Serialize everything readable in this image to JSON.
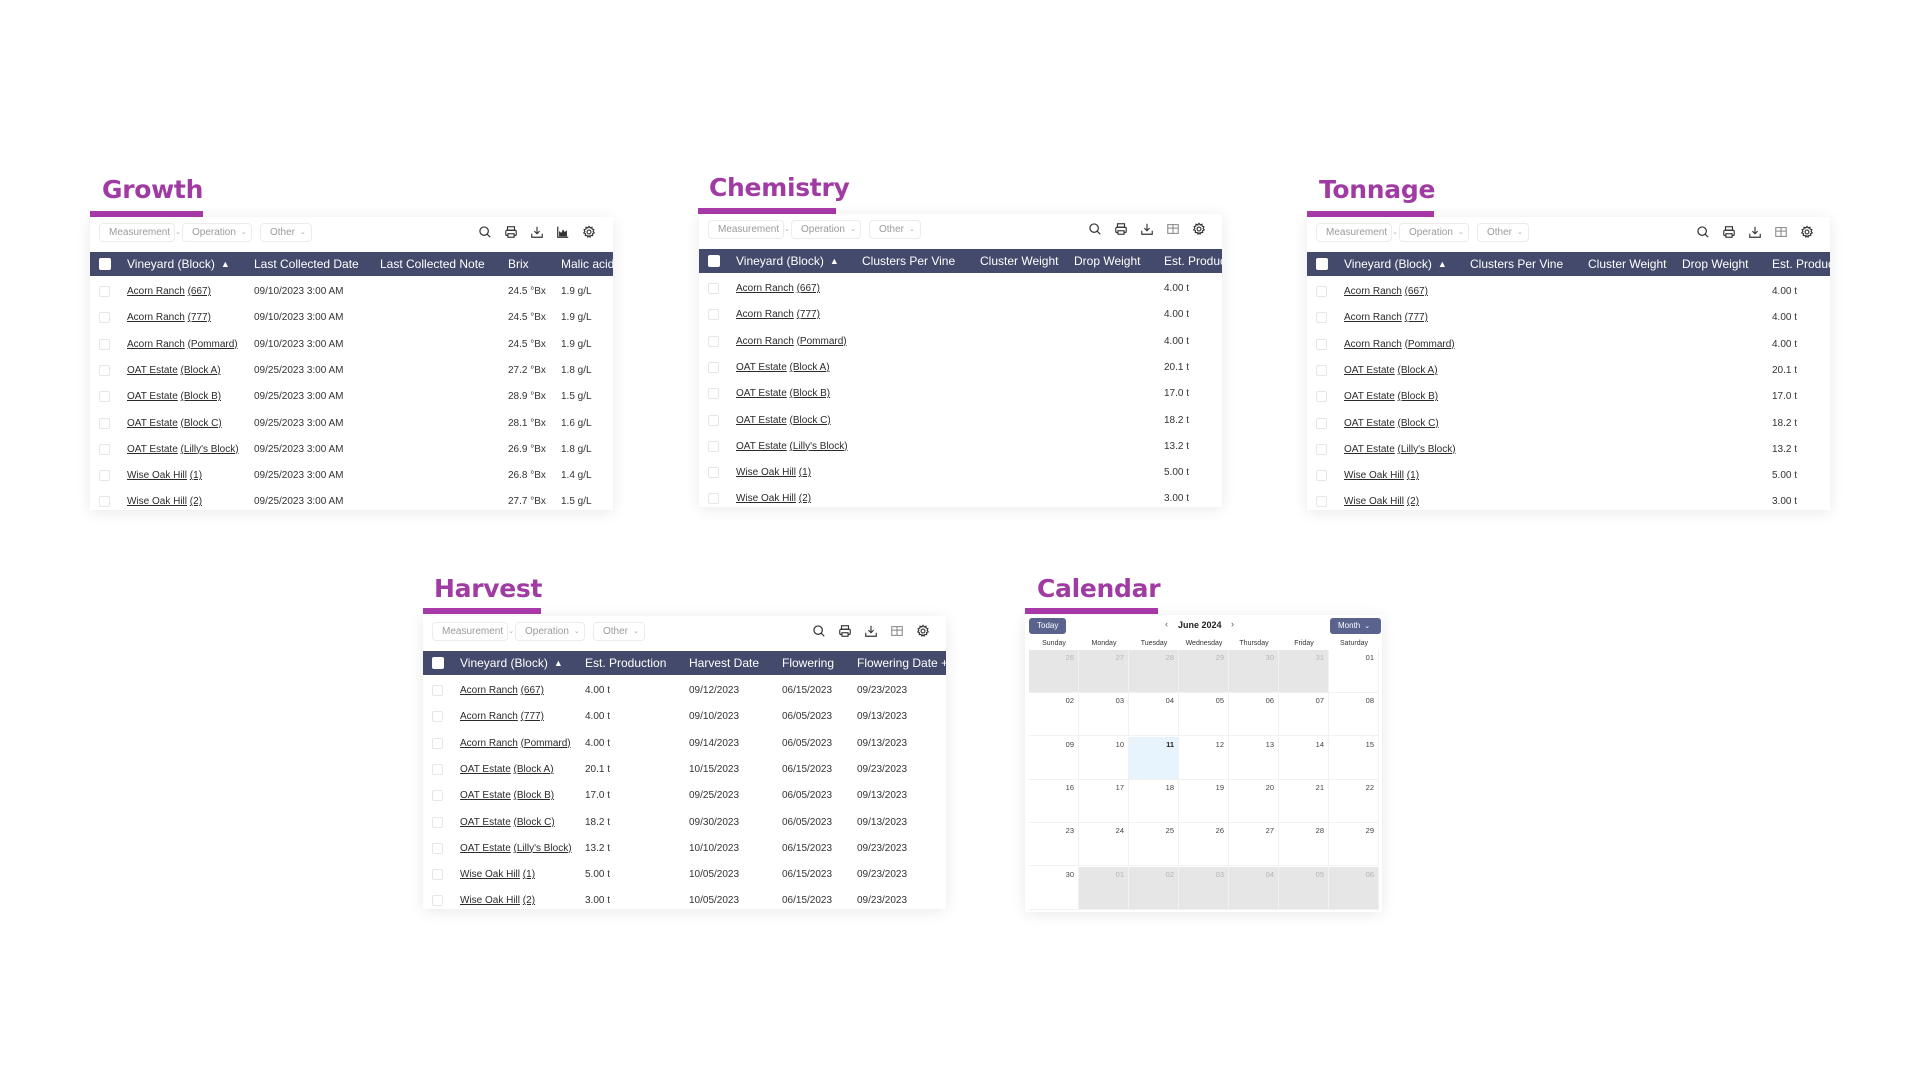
{
  "colors": {
    "title": "#a03ba3",
    "underline": "#a93aaa",
    "header_bg": "#434a6b",
    "calendar_button": "#5a638e",
    "today_bg": "#e8f4fd",
    "other_month_bg": "#e6e6e6"
  },
  "filters": [
    "Measurement",
    "Operation",
    "Other"
  ],
  "icons": {
    "growth": [
      "search-icon",
      "print-icon",
      "download-icon",
      "chart-icon",
      "gear-icon"
    ],
    "default": [
      "search-icon",
      "print-icon",
      "download-icon",
      "columns-icon",
      "gear-icon"
    ]
  },
  "growth": {
    "title": "Growth",
    "columns": [
      "Vineyard (Block)",
      "Last Collected Date",
      "Last Collected Note",
      "Brix",
      "Malic acid"
    ],
    "sort_indicator": "▲",
    "rows": [
      {
        "vineyard": "Acorn Ranch",
        "block": "(667)",
        "date": "09/10/2023 3:00 AM",
        "note": "",
        "brix": "24.5 °Bx",
        "malic": "1.9 g/L"
      },
      {
        "vineyard": "Acorn Ranch",
        "block": "(777)",
        "date": "09/10/2023 3:00 AM",
        "note": "",
        "brix": "24.5 °Bx",
        "malic": "1.9 g/L"
      },
      {
        "vineyard": "Acorn Ranch",
        "block": "(Pommard)",
        "date": "09/10/2023 3:00 AM",
        "note": "",
        "brix": "24.5 °Bx",
        "malic": "1.9 g/L"
      },
      {
        "vineyard": "OAT Estate",
        "block": "(Block A)",
        "date": "09/25/2023 3:00 AM",
        "note": "",
        "brix": "27.2 °Bx",
        "malic": "1.8 g/L"
      },
      {
        "vineyard": "OAT Estate",
        "block": "(Block B)",
        "date": "09/25/2023 3:00 AM",
        "note": "",
        "brix": "28.9 °Bx",
        "malic": "1.5 g/L"
      },
      {
        "vineyard": "OAT Estate",
        "block": "(Block C)",
        "date": "09/25/2023 3:00 AM",
        "note": "",
        "brix": "28.1 °Bx",
        "malic": "1.6 g/L"
      },
      {
        "vineyard": "OAT Estate",
        "block": "(Lilly's Block)",
        "date": "09/25/2023 3:00 AM",
        "note": "",
        "brix": "26.9 °Bx",
        "malic": "1.8 g/L"
      },
      {
        "vineyard": "Wise Oak Hill",
        "block": "(1)",
        "date": "09/25/2023 3:00 AM",
        "note": "",
        "brix": "26.8 °Bx",
        "malic": "1.4 g/L"
      },
      {
        "vineyard": "Wise Oak Hill",
        "block": "(2)",
        "date": "09/25/2023 3:00 AM",
        "note": "",
        "brix": "27.7 °Bx",
        "malic": "1.5 g/L"
      }
    ]
  },
  "chemistry": {
    "title": "Chemistry",
    "columns": [
      "Vineyard (Block)",
      "Clusters Per Vine",
      "Cluster Weight",
      "Drop Weight",
      "Est. Production"
    ],
    "sort_indicator": "▲",
    "rows": [
      {
        "vineyard": "Acorn Ranch",
        "block": "(667)",
        "est": "4.00 t"
      },
      {
        "vineyard": "Acorn Ranch",
        "block": "(777)",
        "est": "4.00 t"
      },
      {
        "vineyard": "Acorn Ranch",
        "block": "(Pommard)",
        "est": "4.00 t"
      },
      {
        "vineyard": "OAT Estate",
        "block": "(Block A)",
        "est": "20.1 t"
      },
      {
        "vineyard": "OAT Estate",
        "block": "(Block B)",
        "est": "17.0 t"
      },
      {
        "vineyard": "OAT Estate",
        "block": "(Block C)",
        "est": "18.2 t"
      },
      {
        "vineyard": "OAT Estate",
        "block": "(Lilly's Block)",
        "est": "13.2 t"
      },
      {
        "vineyard": "Wise Oak Hill",
        "block": "(1)",
        "est": "5.00 t"
      },
      {
        "vineyard": "Wise Oak Hill",
        "block": "(2)",
        "est": "3.00 t"
      }
    ]
  },
  "tonnage": {
    "title": "Tonnage",
    "columns": [
      "Vineyard (Block)",
      "Clusters Per Vine",
      "Cluster Weight",
      "Drop Weight",
      "Est. Production"
    ],
    "sort_indicator": "▲",
    "rows": [
      {
        "vineyard": "Acorn Ranch",
        "block": "(667)",
        "est": "4.00 t"
      },
      {
        "vineyard": "Acorn Ranch",
        "block": "(777)",
        "est": "4.00 t"
      },
      {
        "vineyard": "Acorn Ranch",
        "block": "(Pommard)",
        "est": "4.00 t"
      },
      {
        "vineyard": "OAT Estate",
        "block": "(Block A)",
        "est": "20.1 t"
      },
      {
        "vineyard": "OAT Estate",
        "block": "(Block B)",
        "est": "17.0 t"
      },
      {
        "vineyard": "OAT Estate",
        "block": "(Block C)",
        "est": "18.2 t"
      },
      {
        "vineyard": "OAT Estate",
        "block": "(Lilly's Block)",
        "est": "13.2 t"
      },
      {
        "vineyard": "Wise Oak Hill",
        "block": "(1)",
        "est": "5.00 t"
      },
      {
        "vineyard": "Wise Oak Hill",
        "block": "(2)",
        "est": "3.00 t"
      }
    ]
  },
  "harvest": {
    "title": "Harvest",
    "columns": [
      "Vineyard (Block)",
      "Est. Production",
      "Harvest Date",
      "Flowering",
      "Flowering Date +"
    ],
    "sort_indicator": "▲",
    "rows": [
      {
        "vineyard": "Acorn Ranch",
        "block": "(667)",
        "est": "4.00 t",
        "harvest": "09/12/2023",
        "flowering": "06/15/2023",
        "flowering_plus": "09/23/2023"
      },
      {
        "vineyard": "Acorn Ranch",
        "block": "(777)",
        "est": "4.00 t",
        "harvest": "09/10/2023",
        "flowering": "06/05/2023",
        "flowering_plus": "09/13/2023"
      },
      {
        "vineyard": "Acorn Ranch",
        "block": "(Pommard)",
        "est": "4.00 t",
        "harvest": "09/14/2023",
        "flowering": "06/05/2023",
        "flowering_plus": "09/13/2023"
      },
      {
        "vineyard": "OAT Estate",
        "block": "(Block A)",
        "est": "20.1 t",
        "harvest": "10/15/2023",
        "flowering": "06/15/2023",
        "flowering_plus": "09/23/2023"
      },
      {
        "vineyard": "OAT Estate",
        "block": "(Block B)",
        "est": "17.0 t",
        "harvest": "09/25/2023",
        "flowering": "06/05/2023",
        "flowering_plus": "09/13/2023"
      },
      {
        "vineyard": "OAT Estate",
        "block": "(Block C)",
        "est": "18.2 t",
        "harvest": "09/30/2023",
        "flowering": "06/05/2023",
        "flowering_plus": "09/13/2023"
      },
      {
        "vineyard": "OAT Estate",
        "block": "(Lilly's Block)",
        "est": "13.2 t",
        "harvest": "10/10/2023",
        "flowering": "06/15/2023",
        "flowering_plus": "09/23/2023"
      },
      {
        "vineyard": "Wise Oak Hill",
        "block": "(1)",
        "est": "5.00 t",
        "harvest": "10/05/2023",
        "flowering": "06/15/2023",
        "flowering_plus": "09/23/2023"
      },
      {
        "vineyard": "Wise Oak Hill",
        "block": "(2)",
        "est": "3.00 t",
        "harvest": "10/05/2023",
        "flowering": "06/15/2023",
        "flowering_plus": "09/23/2023"
      }
    ]
  },
  "calendar": {
    "title": "Calendar",
    "today_label": "Today",
    "month_label": "June 2024",
    "prev": "‹",
    "next": "›",
    "view_label": "Month",
    "weekdays": [
      "Sunday",
      "Monday",
      "Tuesday",
      "Wednesday",
      "Thursday",
      "Friday",
      "Saturday"
    ],
    "today": "11",
    "weeks": [
      [
        {
          "d": "26",
          "o": true
        },
        {
          "d": "27",
          "o": true
        },
        {
          "d": "28",
          "o": true
        },
        {
          "d": "29",
          "o": true
        },
        {
          "d": "30",
          "o": true
        },
        {
          "d": "31",
          "o": true
        },
        {
          "d": "01",
          "o": false
        }
      ],
      [
        {
          "d": "02",
          "o": false
        },
        {
          "d": "03",
          "o": false
        },
        {
          "d": "04",
          "o": false
        },
        {
          "d": "05",
          "o": false
        },
        {
          "d": "06",
          "o": false
        },
        {
          "d": "07",
          "o": false
        },
        {
          "d": "08",
          "o": false
        }
      ],
      [
        {
          "d": "09",
          "o": false
        },
        {
          "d": "10",
          "o": false
        },
        {
          "d": "11",
          "o": false
        },
        {
          "d": "12",
          "o": false
        },
        {
          "d": "13",
          "o": false
        },
        {
          "d": "14",
          "o": false
        },
        {
          "d": "15",
          "o": false
        }
      ],
      [
        {
          "d": "16",
          "o": false
        },
        {
          "d": "17",
          "o": false
        },
        {
          "d": "18",
          "o": false
        },
        {
          "d": "19",
          "o": false
        },
        {
          "d": "20",
          "o": false
        },
        {
          "d": "21",
          "o": false
        },
        {
          "d": "22",
          "o": false
        }
      ],
      [
        {
          "d": "23",
          "o": false
        },
        {
          "d": "24",
          "o": false
        },
        {
          "d": "25",
          "o": false
        },
        {
          "d": "26",
          "o": false
        },
        {
          "d": "27",
          "o": false
        },
        {
          "d": "28",
          "o": false
        },
        {
          "d": "29",
          "o": false
        }
      ],
      [
        {
          "d": "30",
          "o": false
        },
        {
          "d": "01",
          "o": true
        },
        {
          "d": "02",
          "o": true
        },
        {
          "d": "03",
          "o": true
        },
        {
          "d": "04",
          "o": true
        },
        {
          "d": "05",
          "o": true
        },
        {
          "d": "06",
          "o": true
        }
      ]
    ]
  }
}
